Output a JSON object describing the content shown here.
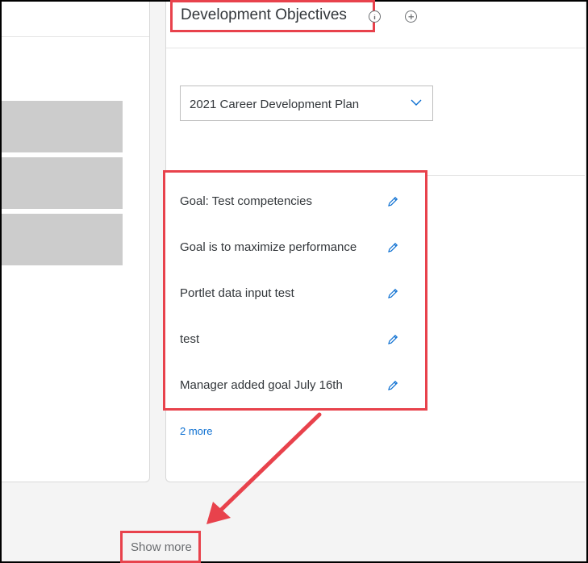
{
  "card": {
    "title": "Development Objectives",
    "info_icon": "info-circle-icon",
    "add_icon": "add-circle-icon"
  },
  "plan_select": {
    "value": "2021 Career Development Plan",
    "icon": "chevron-down-icon"
  },
  "goals": [
    {
      "text": "Goal: Test competencies",
      "icon": "pencil-edit-icon"
    },
    {
      "text": "Goal is to maximize performance",
      "icon": "pencil-edit-icon"
    },
    {
      "text": "Portlet data input test",
      "icon": "pencil-edit-icon"
    },
    {
      "text": "test",
      "icon": "pencil-edit-icon"
    },
    {
      "text": "Manager added goal July 16th",
      "icon": "pencil-edit-icon"
    }
  ],
  "more_link": "2 more",
  "show_more": "Show more",
  "colors": {
    "highlight": "#e8424c",
    "link": "#0a6ed1",
    "placeholder": "#cccccc"
  }
}
